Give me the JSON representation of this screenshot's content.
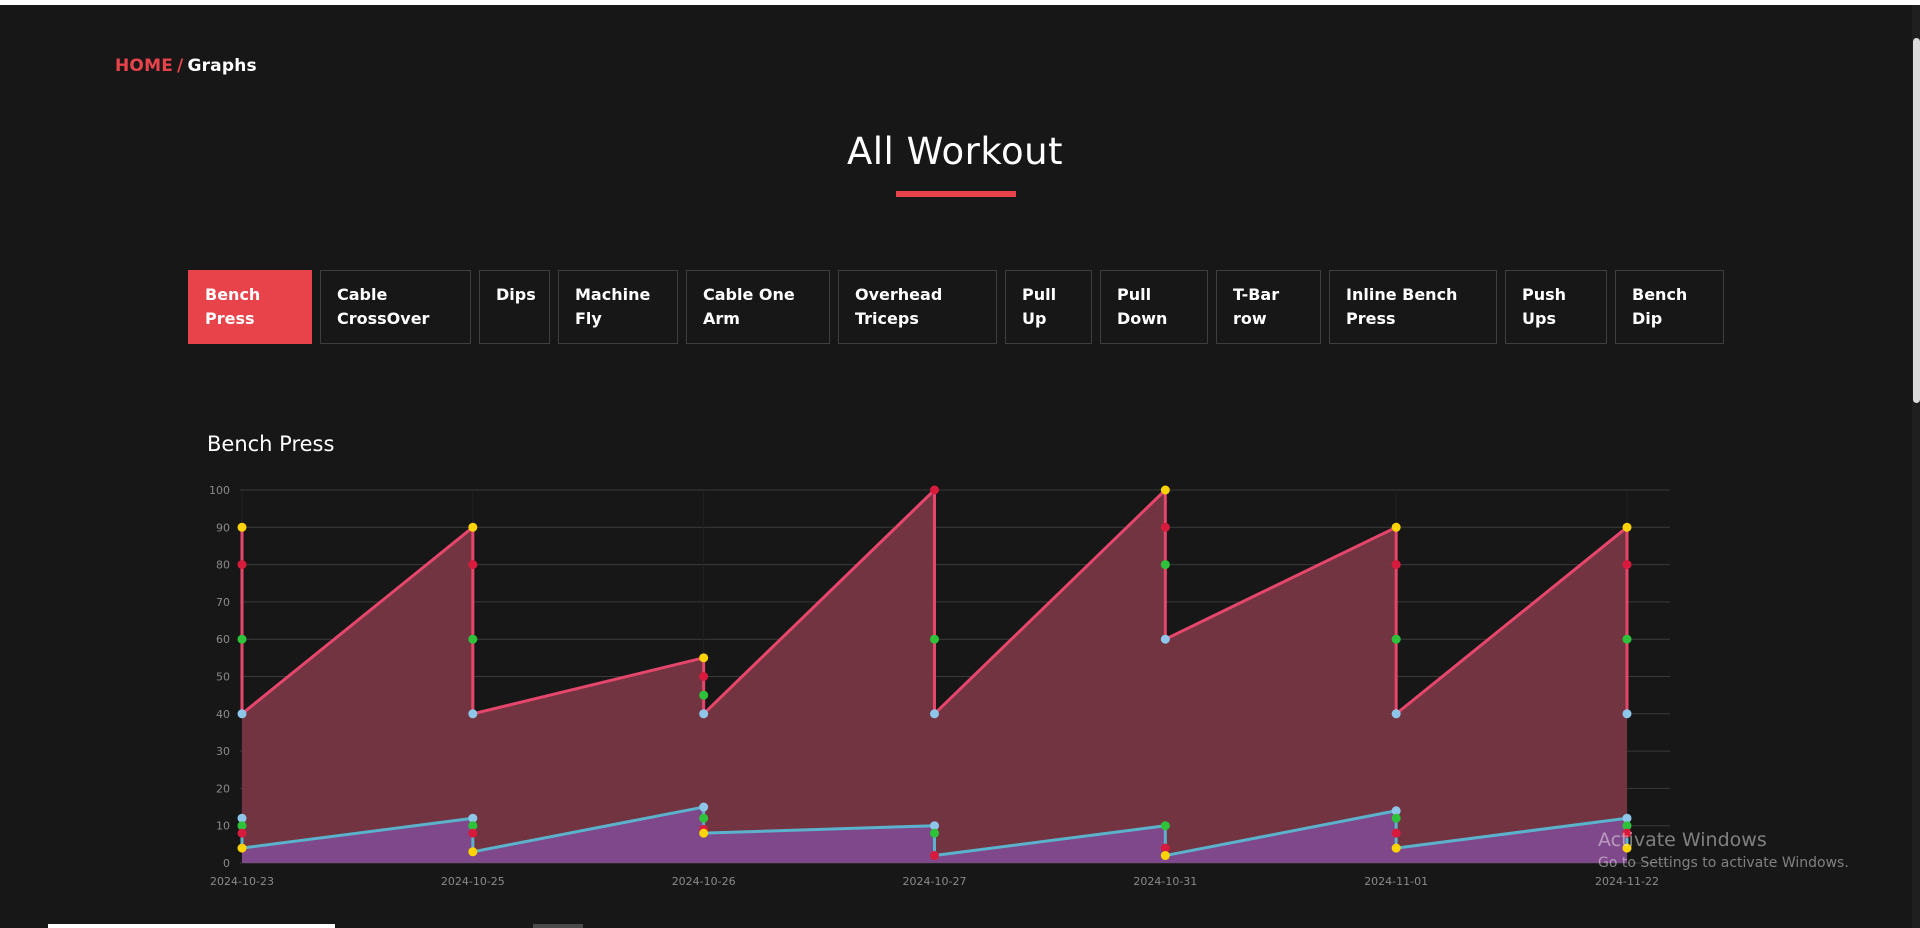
{
  "breadcrumb": {
    "home": "HOME",
    "separator": "/",
    "current": "Graphs"
  },
  "page": {
    "title": "All Workout"
  },
  "tabs": [
    {
      "label": "Bench Press",
      "active": true
    },
    {
      "label": "Cable CrossOver",
      "active": false
    },
    {
      "label": "Dips",
      "active": false
    },
    {
      "label": "Machine Fly",
      "active": false
    },
    {
      "label": "Cable One Arm",
      "active": false
    },
    {
      "label": "Overhead Triceps",
      "active": false
    },
    {
      "label": "Pull Up",
      "active": false
    },
    {
      "label": "Pull Down",
      "active": false
    },
    {
      "label": "T-Bar row",
      "active": false
    },
    {
      "label": "Inline Bench Press",
      "active": false
    },
    {
      "label": "Push Ups",
      "active": false
    },
    {
      "label": "Bench Dip",
      "active": false
    }
  ],
  "chart_title": "Bench Press",
  "chart_data": {
    "type": "area",
    "title": "Bench Press",
    "xlabel": "",
    "ylabel": "",
    "ylim": [
      0,
      100
    ],
    "yticks": [
      0,
      10,
      20,
      30,
      40,
      50,
      60,
      70,
      80,
      90,
      100
    ],
    "grid": true,
    "legend": "none",
    "categories": [
      "2024-10-23",
      "2024-10-25",
      "2024-10-26",
      "2024-10-27",
      "2024-10-31",
      "2024-11-01",
      "2024-11-22"
    ],
    "series": [
      {
        "color": "#e6466b",
        "fill": "#773642",
        "points": [
          {
            "x": "2024-10-23",
            "sets": [
              90,
              80,
              60,
              40
            ]
          },
          {
            "x": "2024-10-25",
            "sets": [
              90,
              80,
              60,
              40
            ]
          },
          {
            "x": "2024-10-26",
            "sets": [
              55,
              50,
              45,
              40
            ]
          },
          {
            "x": "2024-10-27",
            "sets": [
              100,
              60,
              40
            ]
          },
          {
            "x": "2024-10-31",
            "sets": [
              100,
              90,
              80,
              60
            ]
          },
          {
            "x": "2024-11-01",
            "sets": [
              90,
              80,
              60,
              40
            ]
          },
          {
            "x": "2024-11-22",
            "sets": [
              90,
              80,
              60,
              40
            ]
          }
        ]
      },
      {
        "color": "#5bb2cc",
        "fill": "#7f4a8e",
        "points": [
          {
            "x": "2024-10-23",
            "sets": [
              12,
              10,
              8,
              4
            ]
          },
          {
            "x": "2024-10-25",
            "sets": [
              12,
              10,
              8,
              3
            ]
          },
          {
            "x": "2024-10-26",
            "sets": [
              15,
              12,
              9,
              8
            ]
          },
          {
            "x": "2024-10-27",
            "sets": [
              10,
              8,
              2
            ]
          },
          {
            "x": "2024-10-31",
            "sets": [
              10,
              4,
              2
            ]
          },
          {
            "x": "2024-11-01",
            "sets": [
              14,
              12,
              8,
              4
            ]
          },
          {
            "x": "2024-11-22",
            "sets": [
              12,
              10,
              8,
              4
            ]
          }
        ]
      }
    ],
    "marker_colors": {
      "light_blue": "#8ec6ea",
      "green": "#2ec23a",
      "red": "#d81a3c",
      "yellow": "#fcd405"
    },
    "top_marker_values": [
      [
        90,
        80,
        60,
        40
      ],
      [
        90,
        80,
        60,
        40
      ],
      [
        55,
        50,
        45,
        40
      ],
      [
        100,
        60,
        40
      ],
      [
        100,
        90,
        80,
        60
      ],
      [
        90,
        80,
        60,
        40
      ],
      [
        90,
        80,
        60,
        40
      ]
    ],
    "top_marker_colors": [
      [
        "yellow",
        "red",
        "green",
        "light_blue"
      ],
      [
        "yellow",
        "red",
        "green",
        "light_blue"
      ],
      [
        "yellow",
        "red",
        "green",
        "light_blue"
      ],
      [
        "red",
        "green",
        "light_blue"
      ],
      [
        "yellow",
        "red",
        "green",
        "light_blue"
      ],
      [
        "yellow",
        "red",
        "green",
        "light_blue"
      ],
      [
        "yellow",
        "red",
        "green",
        "light_blue"
      ]
    ],
    "bottom_marker_colors": [
      [
        "light_blue",
        "green",
        "red",
        "yellow"
      ],
      [
        "light_blue",
        "green",
        "red",
        "yellow"
      ],
      [
        "light_blue",
        "green",
        "red",
        "yellow"
      ],
      [
        "light_blue",
        "green",
        "red"
      ],
      [
        "green",
        "red",
        "yellow"
      ],
      [
        "light_blue",
        "green",
        "red",
        "yellow"
      ],
      [
        "light_blue",
        "green",
        "red",
        "yellow"
      ]
    ]
  },
  "watermark": {
    "line1": "Activate Windows",
    "line2": "Go to Settings to activate Windows."
  },
  "colors": {
    "accent": "#e8434b",
    "background": "#171717",
    "tab_border": "#3e3e3e"
  }
}
